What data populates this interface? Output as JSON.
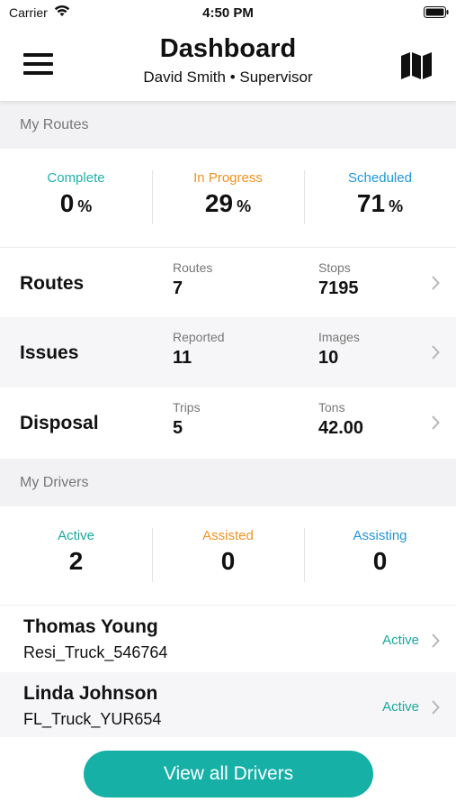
{
  "colors": {
    "complete": "#20b2aa",
    "in_progress": "#f39220",
    "scheduled": "#2196d9",
    "active": "#1aa89e",
    "assisted": "#f39220",
    "assisting": "#2196d9",
    "button_bg": "#16b0a6",
    "alt_row_bg": "#f6f6f8"
  },
  "status_bar": {
    "carrier": "Carrier",
    "time": "4:50 PM",
    "icons": [
      "wifi-icon",
      "battery-icon"
    ]
  },
  "header": {
    "title": "Dashboard",
    "subtitle": "David Smith • Supervisor",
    "left_icon": "menu-icon",
    "right_icon": "map-icon"
  },
  "my_routes": {
    "section_label": "My Routes",
    "stats": [
      {
        "label": "Complete",
        "value": "0",
        "unit": "%"
      },
      {
        "label": "In Progress",
        "value": "29",
        "unit": "%"
      },
      {
        "label": "Scheduled",
        "value": "71",
        "unit": "%"
      }
    ]
  },
  "summary_rows": [
    {
      "name": "Routes",
      "col1_label": "Routes",
      "col1_value": "7",
      "col2_label": "Stops",
      "col2_value": "7195"
    },
    {
      "name": "Issues",
      "col1_label": "Reported",
      "col1_value": "11",
      "col2_label": "Images",
      "col2_value": "10"
    },
    {
      "name": "Disposal",
      "col1_label": "Trips",
      "col1_value": "5",
      "col2_label": "Tons",
      "col2_value": "42.00"
    }
  ],
  "my_drivers": {
    "section_label": "My Drivers",
    "stats": [
      {
        "label": "Active",
        "value": "2"
      },
      {
        "label": "Assisted",
        "value": "0"
      },
      {
        "label": "Assisting",
        "value": "0"
      }
    ]
  },
  "drivers": [
    {
      "name": "Thomas Young",
      "truck": "Resi_Truck_546764",
      "status": "Active"
    },
    {
      "name": "Linda Johnson",
      "truck": "FL_Truck_YUR654",
      "status": "Active"
    }
  ],
  "footer": {
    "button_label": "View all Drivers"
  }
}
